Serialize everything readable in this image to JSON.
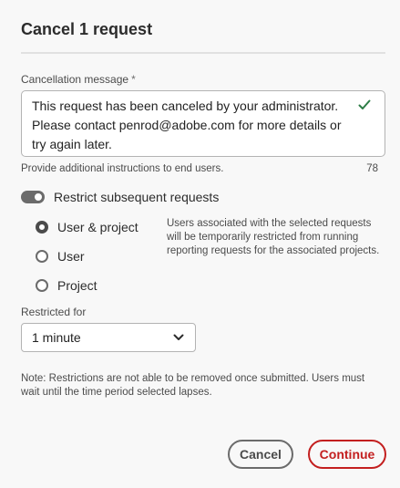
{
  "dialog": {
    "title": "Cancel 1 request"
  },
  "message_field": {
    "label": "Cancellation message",
    "required_mark": "*",
    "value": "This request has been canceled by your administrator. Please contact penrod@adobe.com for more details or try again later.",
    "help_text": "Provide additional instructions to end users.",
    "char_count": "78"
  },
  "restrict_toggle": {
    "label": "Restrict subsequent requests",
    "on": true
  },
  "restrict_options": {
    "items": [
      {
        "label": "User & project",
        "checked": true
      },
      {
        "label": "User",
        "checked": false
      },
      {
        "label": "Project",
        "checked": false
      }
    ],
    "description": "Users associated with the selected requests will be temporarily restricted from running reporting requests for the associated projects."
  },
  "restricted_for": {
    "label": "Restricted for",
    "value": "1 minute"
  },
  "note": "Note: Restrictions are not able to be removed once submitted. Users must wait until the time period selected lapses.",
  "buttons": {
    "cancel": "Cancel",
    "continue": "Continue"
  },
  "colors": {
    "accent_red": "#c31f1f",
    "valid_green": "#2d7d46",
    "toggle_gray": "#6b6b6b"
  },
  "icons": {
    "valid": "checkmark-icon",
    "dropdown": "chevron-down-icon"
  }
}
